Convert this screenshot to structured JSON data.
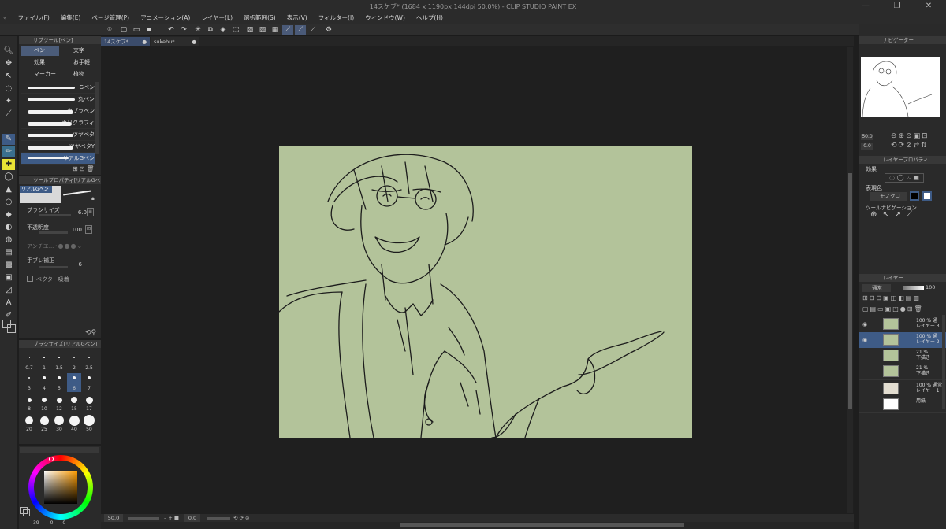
{
  "window": {
    "title": "14スケブ* (1684 x 1190px 144dpi 50.0%) - CLIP STUDIO PAINT EX",
    "controls": [
      "—",
      "❐",
      "✕"
    ]
  },
  "menu": [
    "ファイル(F)",
    "編集(E)",
    "ページ管理(P)",
    "アニメーション(A)",
    "レイヤー(L)",
    "選択範囲(S)",
    "表示(V)",
    "フィルター(I)",
    "ウィンドウ(W)",
    "ヘルプ(H)"
  ],
  "doc_tabs": [
    {
      "label": "14スケブ*",
      "active": true
    },
    {
      "label": "sukebu*",
      "active": false
    }
  ],
  "subtool": {
    "title": "サブツール[ペン]",
    "groups": [
      "ペン",
      "文字",
      "効果",
      "お手軽",
      "マーカー",
      "植物"
    ],
    "brushes": [
      "Gペン",
      "丸ペン",
      "カブラペン",
      "カリグラフィ",
      "ツヤベタ",
      "ツヤベタY",
      "リアルGペン"
    ],
    "selected": "リアルGペン"
  },
  "tool_property": {
    "title": "ツールプロパティ[リアルGペン]",
    "name": "リアルGペン",
    "brush_size_label": "ブラシサイズ",
    "brush_size_value": "6.0",
    "opacity_label": "不透明度",
    "opacity_value": "100",
    "antialias_label": "アンチエ...",
    "stabilization_label": "手ブレ補正",
    "stabilization_value": "6",
    "vector_label": "ベクター吸着"
  },
  "brush_size_palette": {
    "title": "ブラシサイズ[リアルGペン]",
    "sizes": [
      "0.7",
      "1",
      "1.5",
      "2",
      "2.5",
      "3",
      "4",
      "5",
      "6",
      "7",
      "8",
      "10",
      "12",
      "15",
      "17",
      "20",
      "25",
      "30",
      "40",
      "50"
    ],
    "selected": "6"
  },
  "color": {
    "main": "#0d0d0d",
    "sub": "#ffffff",
    "background_paper": "#b3c39a",
    "value_a": "39",
    "value_b": "0",
    "value_c": "0"
  },
  "navigator": {
    "title": "ナビゲーター",
    "zoom": "50.0",
    "angle": "0.0"
  },
  "layer_property": {
    "title": "レイヤープロパティ",
    "effect_label": "効果",
    "color_label": "表現色",
    "color_mode": "モノクロ",
    "tool_nav_label": "ツールナビゲーション"
  },
  "layers_panel": {
    "title": "レイヤー",
    "blend": "通常",
    "opacity": "100",
    "layers": [
      {
        "pct": "100 %",
        "mode": "通",
        "name": "レイヤー 3",
        "thumb": "#b3c39a",
        "visible": true,
        "selected": false
      },
      {
        "pct": "100 %",
        "mode": "通",
        "name": "レイヤー 2",
        "thumb": "#b3c39a",
        "visible": true,
        "selected": true
      },
      {
        "pct": "21 %",
        "mode": "",
        "name": "下描き",
        "thumb": "#b3c39a",
        "visible": false,
        "selected": false
      },
      {
        "pct": "21 %",
        "mode": "",
        "name": "下描き",
        "thumb": "#b3c39a",
        "visible": false,
        "selected": false
      },
      {
        "pct": "100 %",
        "mode": "通常",
        "name": "レイヤー 1",
        "thumb": "#e2ddd0",
        "visible": false,
        "selected": false
      },
      {
        "pct": "",
        "mode": "",
        "name": "用紙",
        "thumb": "#ffffff",
        "visible": false,
        "selected": false
      }
    ]
  },
  "status": {
    "zoom": "50.0",
    "angle": "0.0"
  }
}
